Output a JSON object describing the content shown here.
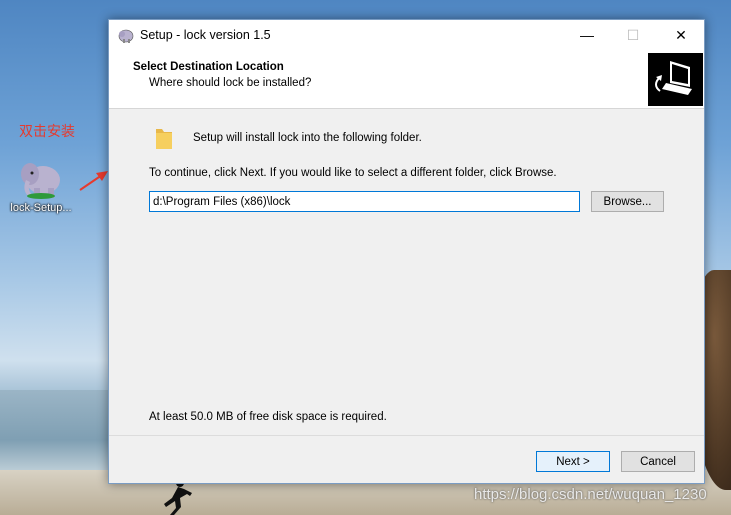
{
  "desktop": {
    "annotation_cn": "双击安装",
    "icon_label": "lock-Setup...",
    "watermark": "https://blog.csdn.net/wuquan_1230"
  },
  "window": {
    "title": "Setup - lock version 1.5",
    "controls": {
      "minimize": "—",
      "maximize": "☐",
      "close": "✕"
    }
  },
  "header": {
    "title": "Select Destination Location",
    "subtitle": "Where should lock be installed?"
  },
  "body": {
    "install_text": "Setup will install lock into the following folder.",
    "continue_text": "To continue, click Next. If you would like to select a different folder, click Browse.",
    "path_value": "d:\\Program Files (x86)\\lock",
    "browse_label": "Browse...",
    "space_text": "At least 50.0 MB of free disk space is required."
  },
  "footer": {
    "next_label": "Next >",
    "cancel_label": "Cancel"
  },
  "colors": {
    "accent": "#0078d7",
    "annotation": "#e63a2e",
    "window_bg": "#f0f0f0"
  }
}
